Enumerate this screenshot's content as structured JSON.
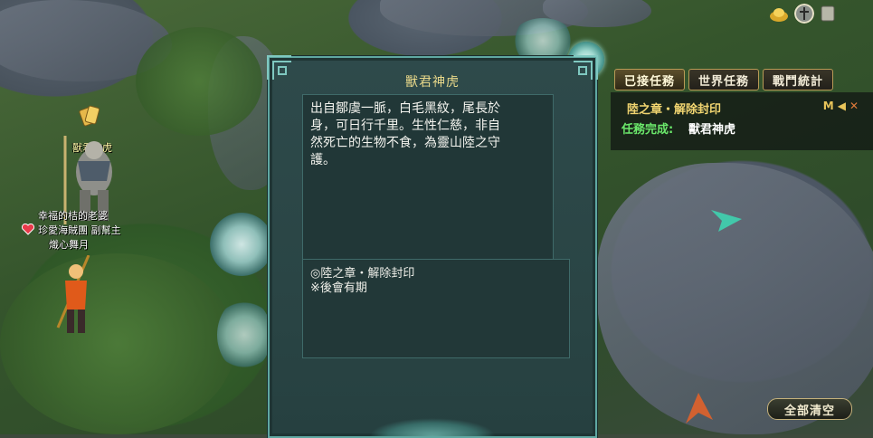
{
  "quest_panel": {
    "title": "獸君神虎",
    "description": "出自鄒虞一脈，白毛黑紋，尾長於\n身，可日行千里。生性仁慈，非自\n然死亡的生物不食，為靈山陸之守\n護。",
    "items": [
      "◎陸之章・解除封印",
      "※後會有期"
    ]
  },
  "quest_tracker": {
    "tabs": [
      "已接任務",
      "世界任務",
      "戰鬥統計"
    ],
    "quest_title": "陸之章・解除封印",
    "status_label": "任務完成:",
    "status_value": "獸君神虎",
    "icon_labels": [
      "M",
      "◀",
      "✕"
    ],
    "clear_all_label": "全部清空"
  },
  "scene": {
    "npc_name": "獸君神虎",
    "player_lines": [
      "幸福的桔的老婆",
      "珍愛海賊團 副幫主",
      "熾心舞月"
    ]
  },
  "icons": {
    "top_right": [
      "gold-ingot-icon",
      "round-shield-icon",
      "scroll-icon"
    ],
    "quest_marker": "scroll-icon",
    "medallion": "lotus-emblem-icon"
  },
  "colors": {
    "panel_border": "#5fa8a2",
    "title_gold": "#e9d98a",
    "quest_gold": "#f0d470",
    "status_green": "#6be86b"
  }
}
